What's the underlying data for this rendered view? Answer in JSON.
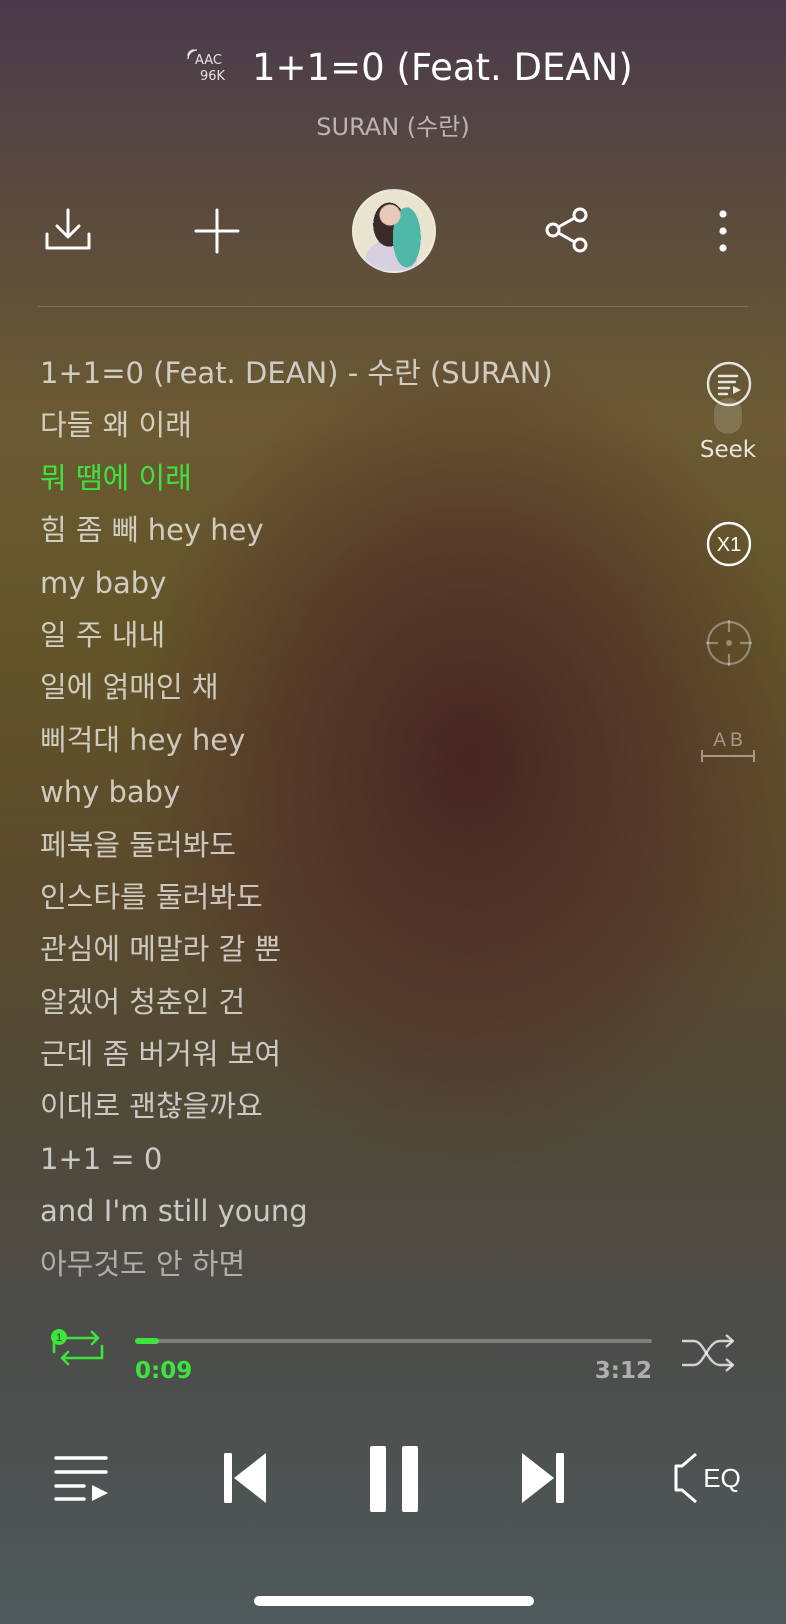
{
  "header": {
    "quality_line1": "AAC",
    "quality_line2": "96K",
    "song_title": "1+1=0 (Feat. DEAN)",
    "artist": "SURAN (수란)"
  },
  "toolbar": {
    "icons": [
      "download-icon",
      "add-icon",
      "album-art",
      "share-icon",
      "more-icon"
    ]
  },
  "lyrics": {
    "active_index": 2,
    "lines": [
      "1+1=0 (Feat. DEAN) - 수란 (SURAN)",
      "다들 왜 이래",
      "뭐 땜에 이래",
      "힘 좀 빼 hey hey",
      "my baby",
      "일 주 내내",
      "일에 얽매인 채",
      "삐걱대 hey hey",
      "why baby",
      "페북을 둘러봐도",
      "인스타를 둘러봐도",
      "관심에 메말라 갈 뿐",
      "알겠어 청춘인 건",
      "근데 좀 버거워 보여",
      "이대로 괜찮을까요",
      "1+1 = 0",
      "and I'm still young",
      "아무것도 안 하면"
    ]
  },
  "side_controls": {
    "seek_label": "Seek",
    "speed_label": "X1",
    "ab_label": "A B"
  },
  "player": {
    "repeat_badge": "1",
    "elapsed": "0:09",
    "total": "3:12",
    "progress_fraction": 0.047,
    "eq_label": "EQ",
    "accent_color": "#3ee33e"
  }
}
